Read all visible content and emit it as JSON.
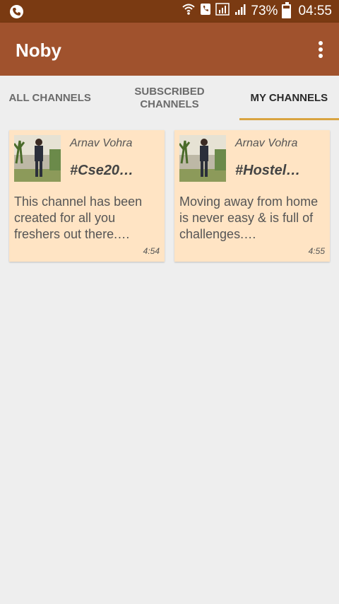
{
  "status_bar": {
    "battery_percent": "73%",
    "time": "04:55",
    "battery_level": 0.73
  },
  "app_bar": {
    "title": "Noby"
  },
  "tabs": [
    {
      "label": "ALL CHANNELS",
      "active": false
    },
    {
      "label": "SUBSCRIBED CHANNELS",
      "active": false
    },
    {
      "label": "MY CHANNELS",
      "active": true
    }
  ],
  "channels": [
    {
      "author": "Arnav Vohra",
      "tag": "#Cse20…",
      "description": "This channel has been created for all you freshers out there.…",
      "time": "4:54"
    },
    {
      "author": "Arnav Vohra",
      "tag": "#Hostel…",
      "description": "Moving away from home is never easy & is full of challenges.…",
      "time": "4:55"
    }
  ],
  "colors": {
    "status_bar": "#7a3a12",
    "app_bar": "#a0522d",
    "card_bg": "#ffe4c4",
    "tab_indicator": "#d9a441"
  }
}
